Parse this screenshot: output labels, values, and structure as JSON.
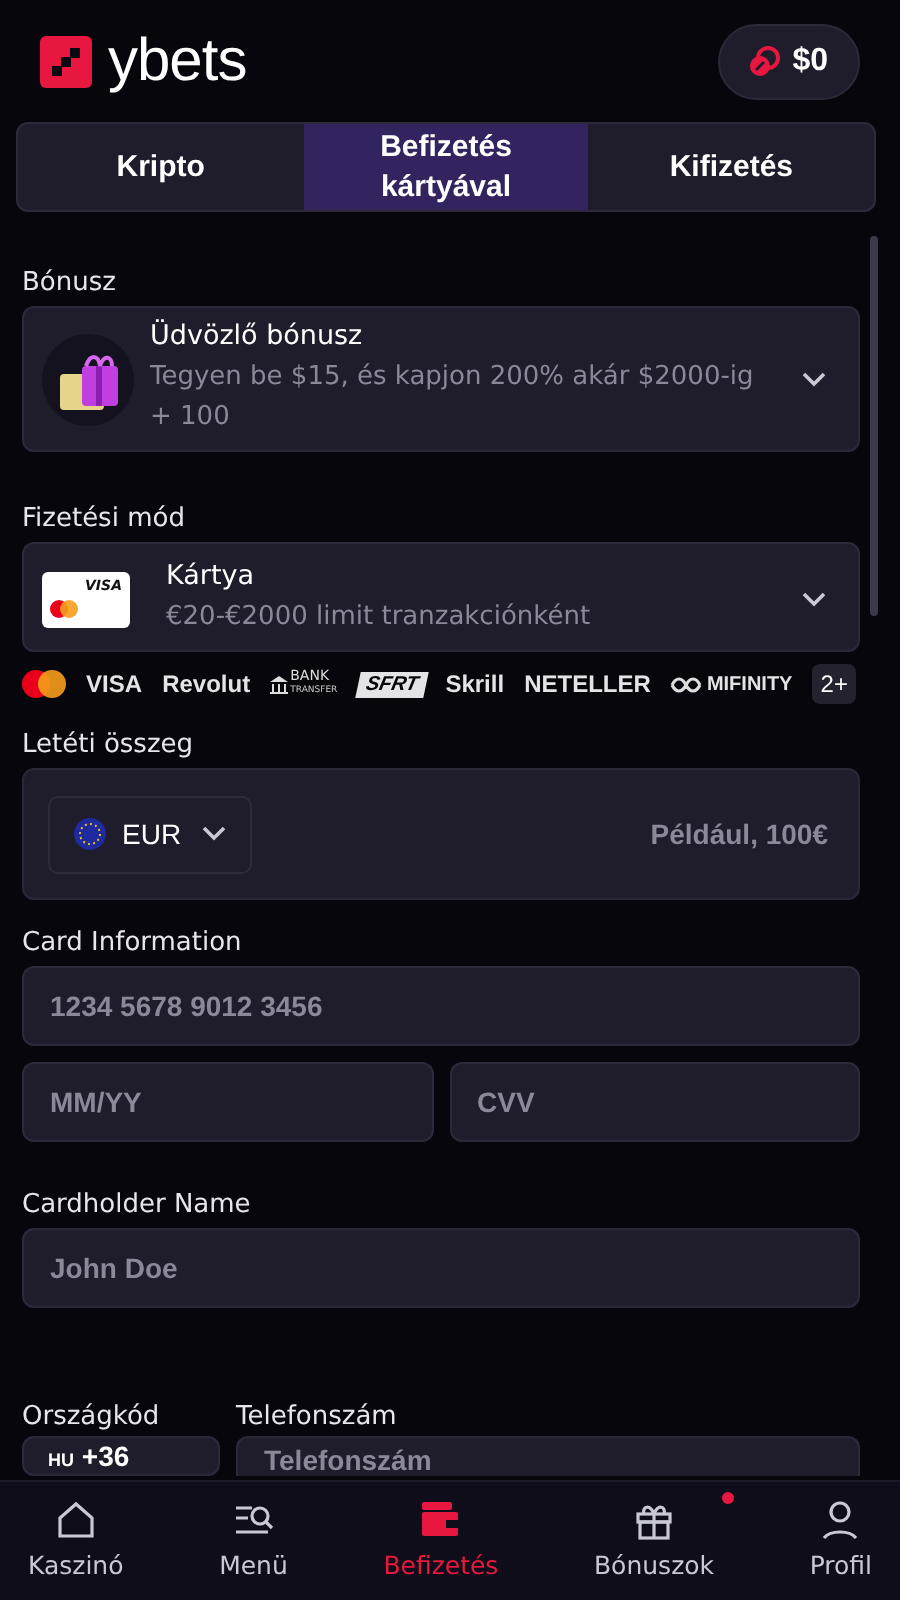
{
  "header": {
    "logo": "ybets",
    "balance": "$0"
  },
  "tabs": [
    {
      "label": "Kripto",
      "selected": false
    },
    {
      "label": "Befizetés kártyával",
      "selected": true
    },
    {
      "label": "Kifizetés",
      "selected": false
    }
  ],
  "bonus": {
    "label": "Bónusz",
    "title": "Üdvözlő bónusz",
    "description": "Tegyen be $15, és kapjon 200% akár $2000-ig + 100"
  },
  "payment_method": {
    "label": "Fizetési mód",
    "title": "Kártya",
    "description": "€20-€2000 limit tranzakciónként",
    "card_brand": "VISA"
  },
  "providers": [
    {
      "kind": "mastercard"
    },
    {
      "kind": "text",
      "label": "VISA"
    },
    {
      "kind": "text",
      "label": "Revolut"
    },
    {
      "kind": "bank",
      "label": "BANK",
      "sub": "TRANSFER"
    },
    {
      "kind": "box",
      "label": "SFRT"
    },
    {
      "kind": "text",
      "label": "Skrill"
    },
    {
      "kind": "text",
      "label": "NETELLER"
    },
    {
      "kind": "mifinity",
      "label": "MIFINITY"
    },
    {
      "kind": "more",
      "label": "2+"
    }
  ],
  "amount": {
    "label": "Letéti összeg",
    "currency": "EUR",
    "placeholder": "Például, 100€"
  },
  "card_info": {
    "label": "Card Information",
    "number_placeholder": "1234 5678 9012 3456",
    "expiry_placeholder": "MM/YY",
    "cvv_placeholder": "CVV"
  },
  "cardholder": {
    "label": "Cardholder Name",
    "placeholder": "John Doe"
  },
  "phone": {
    "country_label": "Országkód",
    "country_flag": "HU",
    "country_code": "+36",
    "number_label": "Telefonszám",
    "number_placeholder": "Telefonszám"
  },
  "nav": [
    {
      "kind": "home",
      "label": "Kaszinó",
      "selected": false,
      "badge": false
    },
    {
      "kind": "menu",
      "label": "Menü",
      "selected": false,
      "badge": false
    },
    {
      "kind": "wallet",
      "label": "Befizetés",
      "selected": true,
      "badge": false
    },
    {
      "kind": "gift",
      "label": "Bónuszok",
      "selected": false,
      "badge": true
    },
    {
      "kind": "user",
      "label": "Profil",
      "selected": false,
      "badge": false
    }
  ]
}
